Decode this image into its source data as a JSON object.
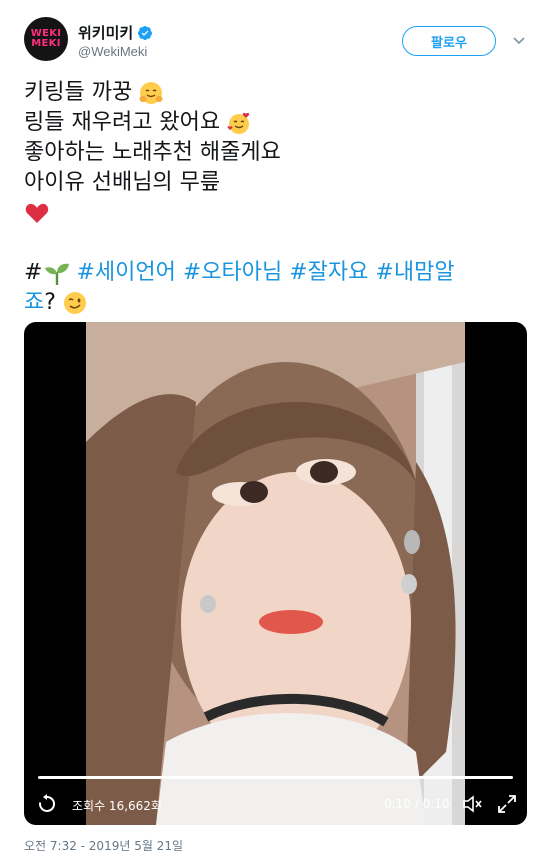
{
  "profile": {
    "logo_line1": "WEKI",
    "logo_line2": "MEKI",
    "display_name": "위키미키",
    "handle": "@WekiMeki",
    "verified_icon": "verified-badge-icon",
    "brand_color": "#1da1f2"
  },
  "actions": {
    "follow_label": "팔로우",
    "more_icon": "chevron-down-icon"
  },
  "tweet": {
    "lines": [
      "키링들 까꿍",
      "링들 재우려고 왔어요",
      "좋아하는 노래추천 해줄게요",
      "아이유 선배님의 무릎"
    ],
    "hash_prefix": "#",
    "hashtags": [
      "#세이언어",
      "#오타아님",
      "#잘자요",
      "#내맘알"
    ],
    "tail_tag": "죠",
    "tail_suffix": "?",
    "emojis": [
      "hugging-face",
      "smiling-face-with-hearts",
      "red-heart",
      "seedling",
      "winking-face"
    ],
    "link_color": "#1b95e0"
  },
  "video": {
    "views": "조회수 16,662회",
    "timecode": "0:10 / 0:10",
    "progress": 1.0
  },
  "meta": {
    "timestamp": "오전 7:32 - 2019년 5월 21일"
  }
}
